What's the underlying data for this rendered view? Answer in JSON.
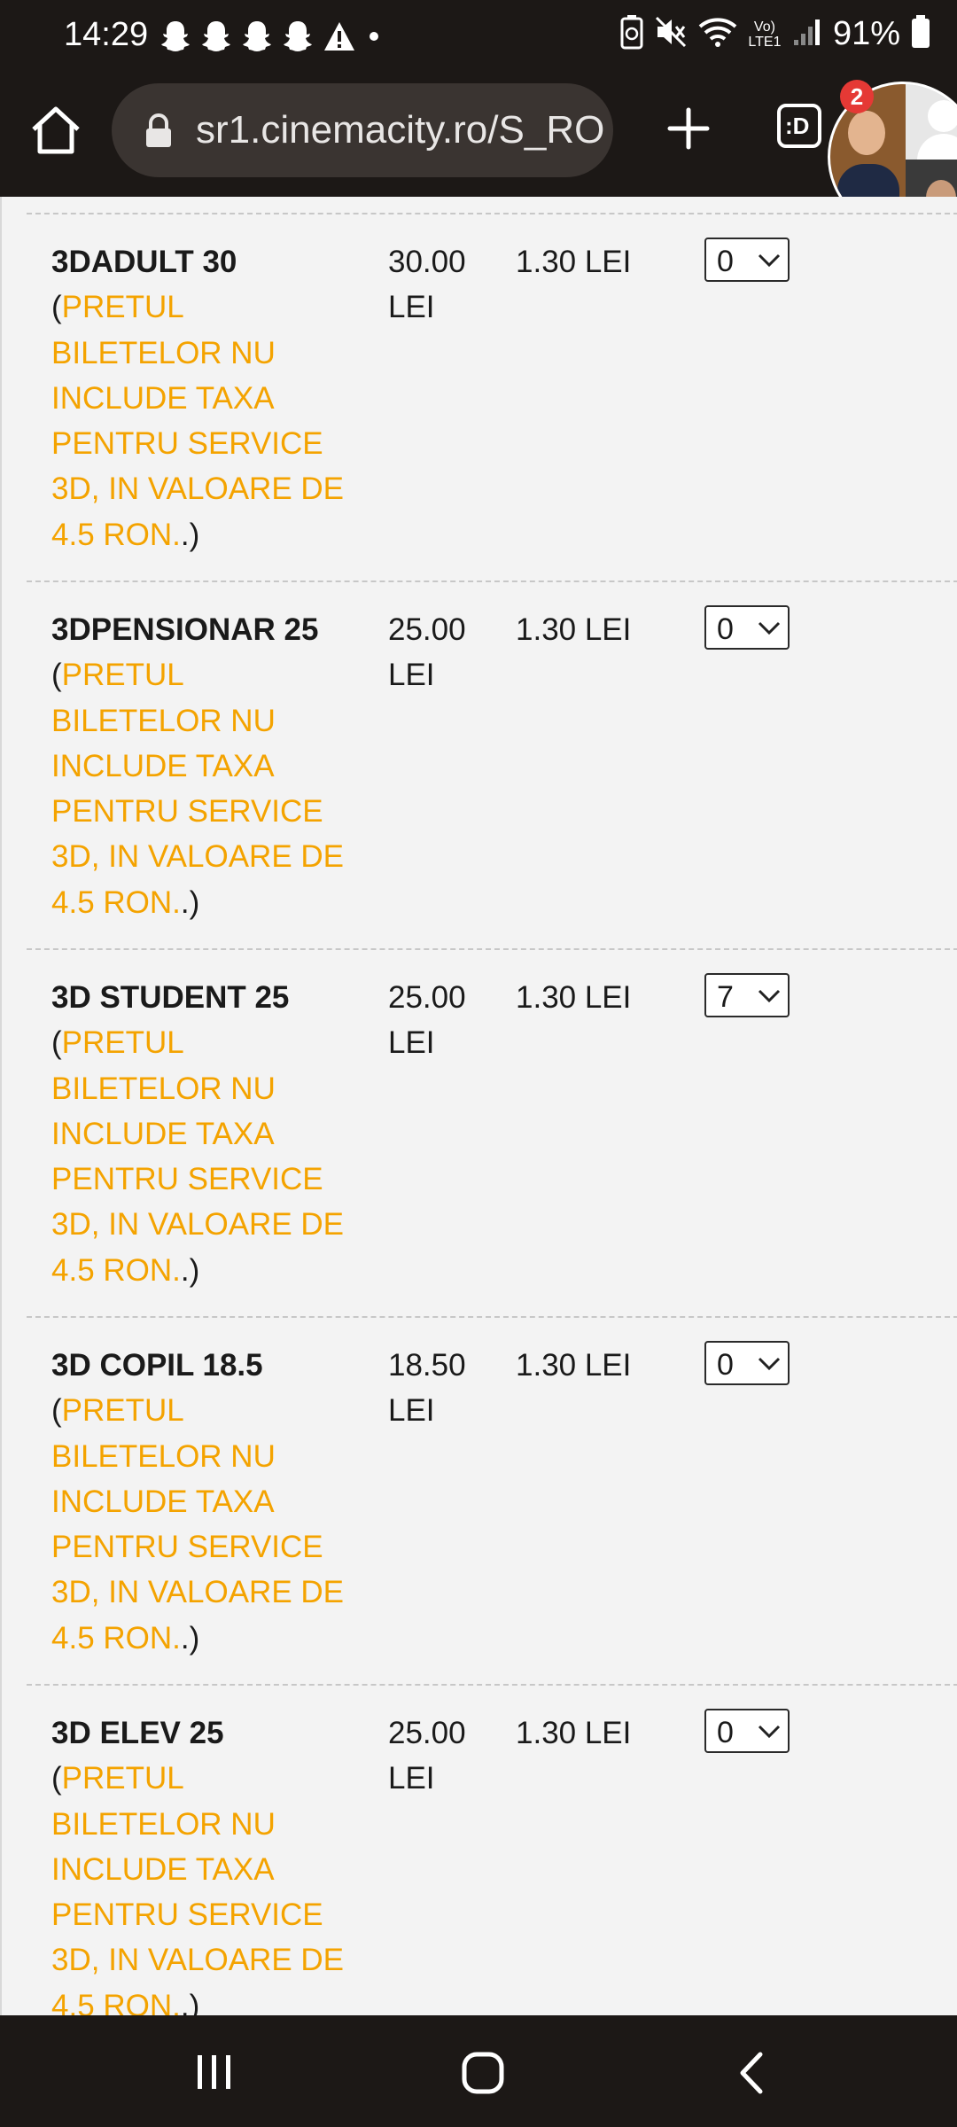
{
  "status_bar": {
    "time": "14:29",
    "battery_percent": "91%",
    "network_label": "Vo) LTE1",
    "notification_icons": [
      "snapchat-icon",
      "snapchat-icon",
      "snapchat-icon",
      "snapchat-icon",
      "warning-icon",
      "dot-icon"
    ],
    "system_icons": [
      "battery-saver-icon",
      "mute-icon",
      "wifi-icon",
      "signal-icon",
      "battery-icon"
    ]
  },
  "browser": {
    "url": "sr1.cinemacity.ro/S_RO",
    "tab_indicator": ":D",
    "chathead_badge": "2"
  },
  "tickets": [
    {
      "name": "3DADULT 30",
      "note": "PRETUL BILETELOR NU INCLUDE TAXA PENTRU SERVICE 3D, IN VALOARE DE 4.5 RON.",
      "price": "30.00 LEI",
      "fee": "1.30 LEI",
      "quantity": "0"
    },
    {
      "name": "3DPENSIONAR 25",
      "note": "PRETUL BILETELOR NU INCLUDE TAXA PENTRU SERVICE 3D, IN VALOARE DE 4.5 RON.",
      "price": "25.00 LEI",
      "fee": "1.30 LEI",
      "quantity": "0"
    },
    {
      "name": "3D STUDENT 25",
      "note": "PRETUL BILETELOR NU INCLUDE TAXA PENTRU SERVICE 3D, IN VALOARE DE 4.5 RON.",
      "price": "25.00 LEI",
      "fee": "1.30 LEI",
      "quantity": "7"
    },
    {
      "name": "3D COPIL 18.5",
      "note": "PRETUL BILETELOR NU INCLUDE TAXA PENTRU SERVICE 3D, IN VALOARE DE 4.5 RON.",
      "price": "18.50 LEI",
      "fee": "1.30 LEI",
      "quantity": "0"
    },
    {
      "name": "3D ELEV 25",
      "note": "PRETUL BILETELOR NU INCLUDE TAXA PENTRU SERVICE 3D, IN VALOARE DE 4.5 RON.",
      "price": "25.00 LEI",
      "fee": "1.30 LEI",
      "quantity": "0"
    }
  ],
  "colors": {
    "note_text": "#f4a300",
    "chrome_background": "#1c1816",
    "page_background": "#f3f3f3"
  }
}
